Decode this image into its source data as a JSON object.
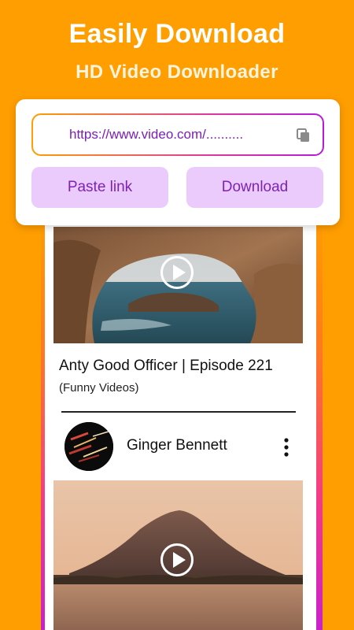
{
  "header": {
    "title": "Easily Download",
    "subtitle": "HD Video Downloader"
  },
  "url_box": {
    "url_value": "https://www.video.com/..........",
    "copy_icon": "copy-icon",
    "paste_label": "Paste link",
    "download_label": "Download"
  },
  "feed": {
    "video1": {
      "title": "Anty Good Officer | Episode 221",
      "category": "(Funny Videos)"
    },
    "author": {
      "name": "Ginger Bennett"
    }
  },
  "colors": {
    "background": "#FF9E00",
    "button_bg": "#EBCBFB",
    "button_text": "#7E22B5",
    "accent_purple": "#B51CDB"
  }
}
